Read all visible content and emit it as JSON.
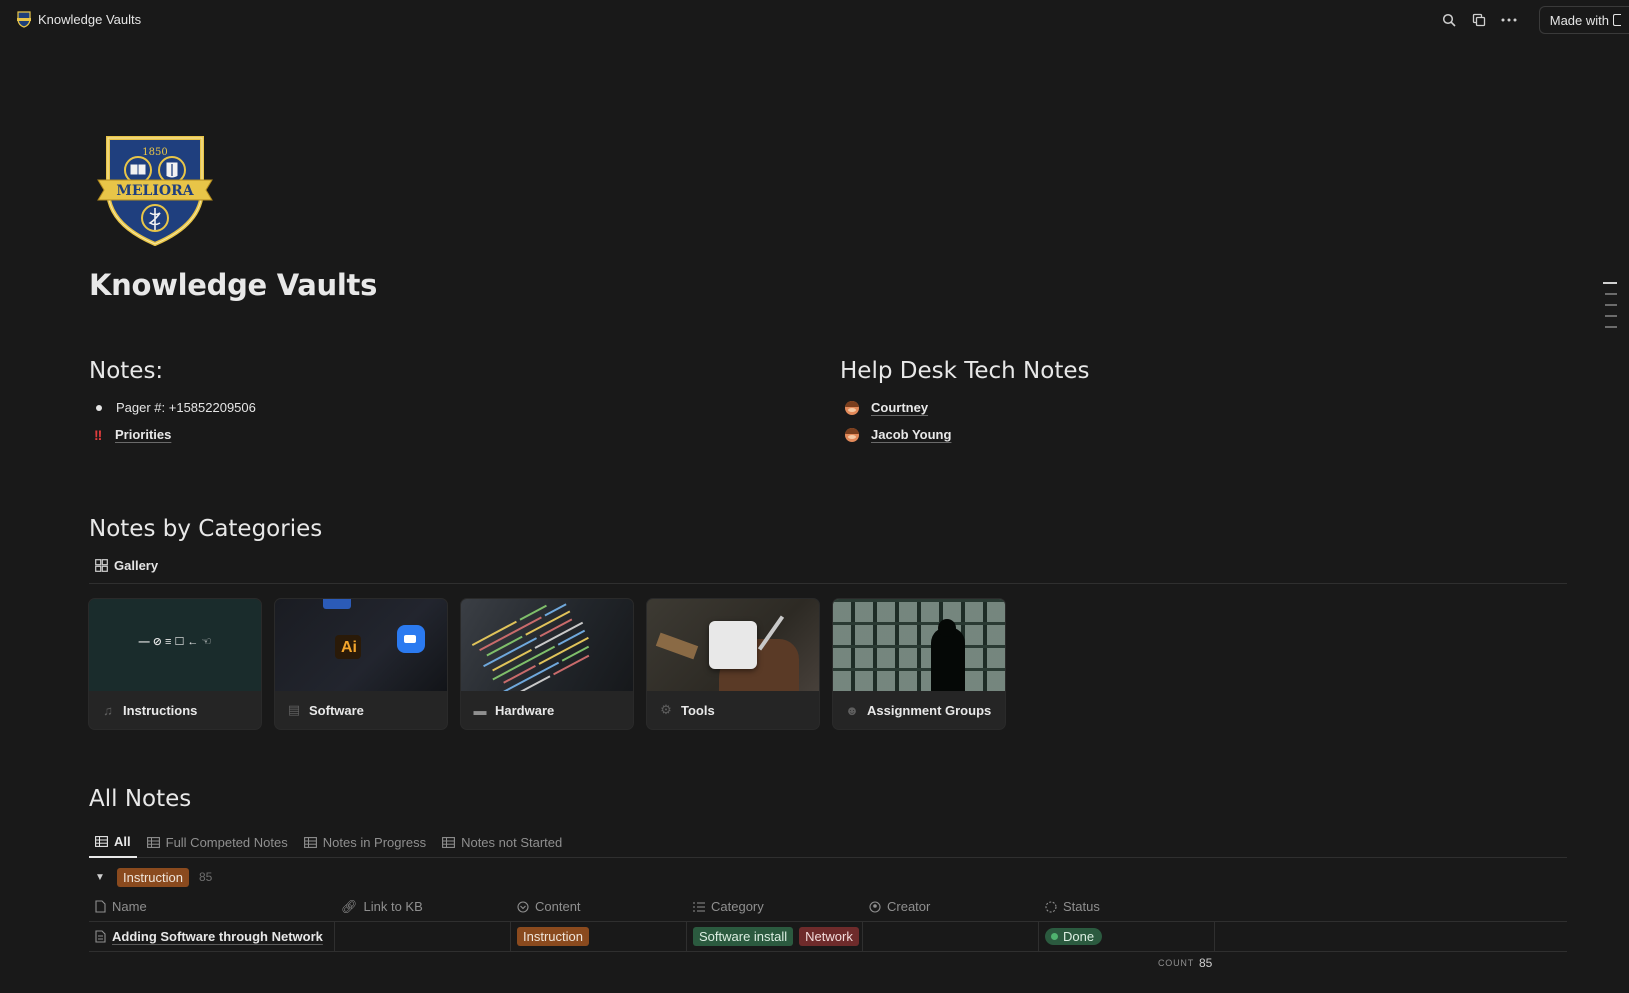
{
  "topbar": {
    "breadcrumb": "Knowledge Vaults",
    "made_with": "Made with",
    "icons": [
      "search-icon",
      "duplicate-icon",
      "more-icon"
    ]
  },
  "page": {
    "title": "Knowledge Vaults",
    "logo": {
      "year": "1850",
      "motto": "MELIORA"
    }
  },
  "notes": {
    "heading": "Notes:",
    "items": [
      {
        "text": "Pager #: +15852209506"
      },
      {
        "text": "Priorities",
        "icon": "!!"
      }
    ]
  },
  "help_desk": {
    "heading": "Help Desk Tech Notes",
    "items": [
      {
        "text": "Courtney"
      },
      {
        "text": "Jacob Young"
      }
    ]
  },
  "categories": {
    "heading": "Notes by Categories",
    "view_label": "Gallery",
    "cards": [
      {
        "label": "Instructions",
        "thumb_text": "— ⊘ ≡ ☐ ← ☜"
      },
      {
        "label": "Software",
        "thumb_text": "Ai"
      },
      {
        "label": "Hardware"
      },
      {
        "label": "Tools"
      },
      {
        "label": "Assignment Groups"
      }
    ]
  },
  "all_notes": {
    "heading": "All Notes",
    "tabs": [
      {
        "label": "All",
        "active": true
      },
      {
        "label": "Full Competed Notes"
      },
      {
        "label": "Notes in Progress"
      },
      {
        "label": "Notes not Started"
      }
    ],
    "group": {
      "label": "Instruction",
      "count": "85"
    },
    "columns": [
      "Name",
      "Link to KB",
      "Content",
      "Category",
      "Creator",
      "Status"
    ],
    "rows": [
      {
        "name": "Adding Software through Network",
        "link": "",
        "content": "Instruction",
        "category": [
          "Software install",
          "Network"
        ],
        "creator": "",
        "status": "Done"
      }
    ],
    "count_label": "COUNT",
    "count_value": "85"
  },
  "colors": {
    "background": "#191919",
    "tag_orange": "#8a4a1e",
    "tag_green": "#2b5a3f",
    "tag_red": "#6e2b2b",
    "priority_red": "#e03c3c"
  }
}
